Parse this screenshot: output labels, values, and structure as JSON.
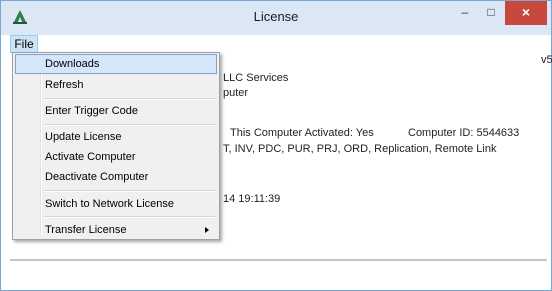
{
  "window": {
    "title": "License",
    "controls": {
      "minimize": "–",
      "maximize": "□",
      "close": "×"
    }
  },
  "menubar": {
    "file_label": "File"
  },
  "file_menu": {
    "items": [
      {
        "label": "Downloads"
      },
      {
        "label": "Refresh"
      },
      {
        "label": "Enter Trigger Code"
      },
      {
        "label": "Update License"
      },
      {
        "label": "Activate Computer"
      },
      {
        "label": "Deactivate Computer"
      },
      {
        "label": "Switch to Network License"
      },
      {
        "label": "Transfer License"
      }
    ]
  },
  "content": {
    "version": "v5.",
    "company": "LLC Services",
    "computer": "puter",
    "activated": "This Computer Activated: Yes",
    "computer_id": "Computer ID: 5544633",
    "modules": "T, INV, PDC, PUR, PRJ, ORD, Replication, Remote Link",
    "timestamp": "14 19:11:39"
  },
  "colors": {
    "titlebar": "#dbe7f5",
    "close_button": "#c7483d",
    "highlight": "#d5e6f8"
  },
  "icons": {
    "app": "app-logo-icon",
    "submenu": "submenu-arrow-icon"
  }
}
